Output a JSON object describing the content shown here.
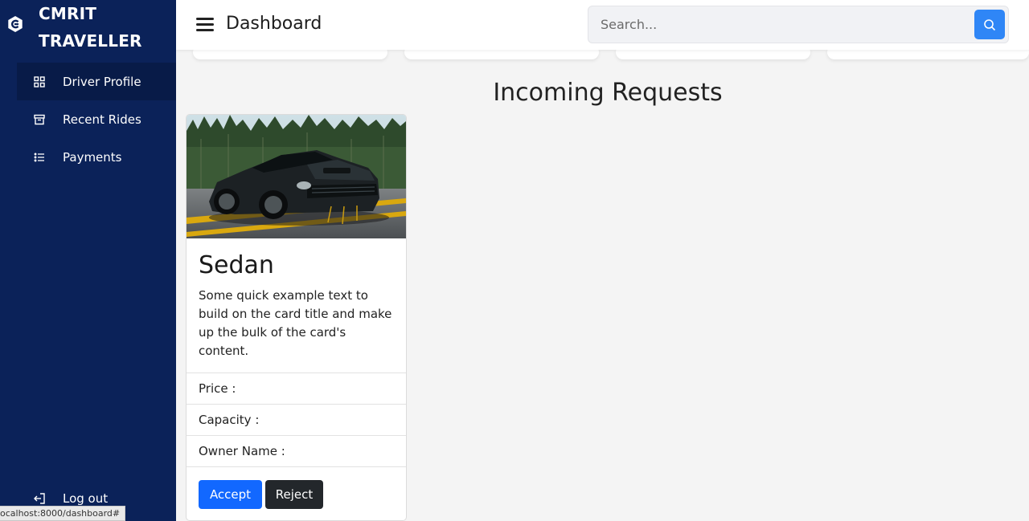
{
  "app": {
    "brand_line1": "CMRIT",
    "brand_line2": "TRAVELLER"
  },
  "sidebar": {
    "items": [
      {
        "label": "Driver Profile",
        "icon": "grid-icon",
        "active": true
      },
      {
        "label": "Recent Rides",
        "icon": "archive-icon",
        "active": false
      },
      {
        "label": "Payments",
        "icon": "list-icon",
        "active": false
      }
    ],
    "logout_label": "Log out"
  },
  "header": {
    "title": "Dashboard",
    "search_placeholder": "Search..."
  },
  "main": {
    "section_title": "Incoming Requests",
    "card": {
      "image_alt": "car-photo",
      "title": "Sedan",
      "text": "Some quick example text to build on the card title and make up the bulk of the card's content.",
      "fields": [
        {
          "label": "Price :"
        },
        {
          "label": "Capacity :"
        },
        {
          "label": "Owner Name :"
        }
      ],
      "accept_label": "Accept",
      "reject_label": "Reject"
    }
  },
  "status_bar": {
    "url": "ocalhost:8000/dashboard#"
  },
  "colors": {
    "sidebar_bg": "#0b2259",
    "accent": "#1268ff",
    "search_button": "#2f86f6",
    "reject_button": "#23272b",
    "page_bg": "#f4f4f4"
  }
}
